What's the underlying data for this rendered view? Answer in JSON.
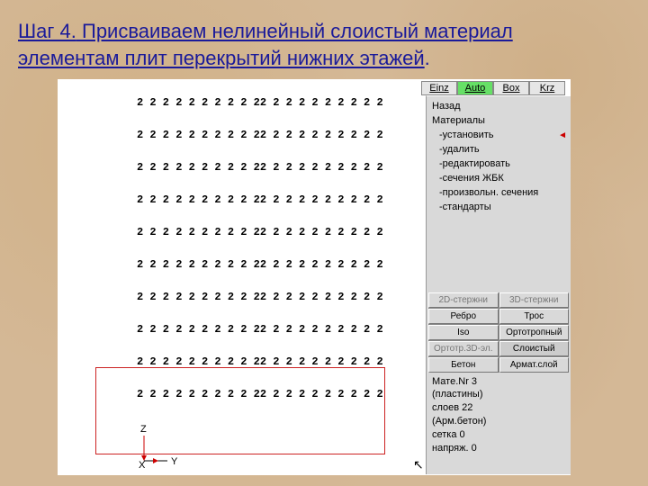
{
  "title_line1_a": "Шаг 4.",
  "title_line1_b": " Присваиваем нелинейный слоистый материал",
  "title_line2": "элементам плит перекрытий нижних этажей",
  "modes": {
    "einz": "Einz",
    "auto": "Auto",
    "box": "Box",
    "krz": "Krz"
  },
  "row_pattern": "2 2 2 2 2 2 2 2 2 22 2 2 2 2 2 2 2 2 2",
  "axis": {
    "x": "X",
    "y": "Y",
    "z": "Z"
  },
  "menu": {
    "back": "Назад",
    "materials": "Материалы",
    "set": "-установить",
    "del": "-удалить",
    "edit": "-редактировать",
    "sect": "-сечения ЖБК",
    "free": "-произвольн. сечения",
    "std": "-стандарты"
  },
  "grid": {
    "c2d": "2D-стержни",
    "c3d": "3D-стержни",
    "rib": "Ребро",
    "cable": "Трос",
    "iso": "Iso",
    "ortho": "Ортотропный",
    "ortho3d": "Ортотр.3D-эл.",
    "layered": "Слоистый",
    "concrete": "Бетон",
    "rebar": "Армат.слой"
  },
  "info": {
    "l1": "Мате.Nr 3",
    "l2": "(пластины)",
    "l3": "слоев   22",
    "l4": "(Арм.бетон)",
    "l5": "сетка   0",
    "l6": "напряж.  0"
  }
}
